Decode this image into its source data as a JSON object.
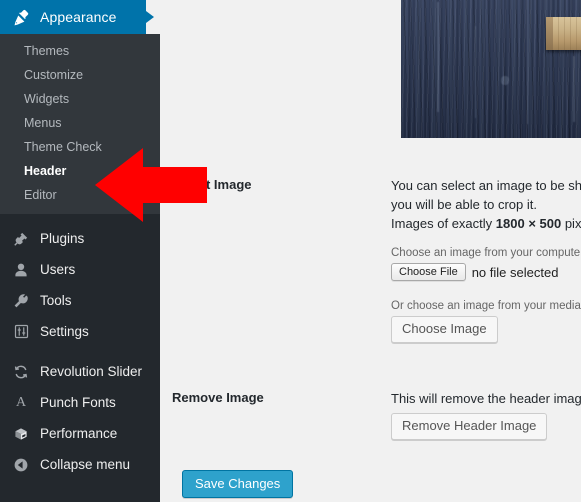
{
  "sidebar": {
    "top_menu": {
      "label": "Appearance",
      "icon": "paintbrush-icon",
      "background_color": "#0073aa",
      "expanded": true
    },
    "submenu": [
      {
        "label": "Themes",
        "current": false
      },
      {
        "label": "Customize",
        "current": false
      },
      {
        "label": "Widgets",
        "current": false
      },
      {
        "label": "Menus",
        "current": false
      },
      {
        "label": "Theme Check",
        "current": false
      },
      {
        "label": "Header",
        "current": true
      },
      {
        "label": "Editor",
        "current": false
      }
    ],
    "menu_items": [
      {
        "label": "Plugins",
        "icon": "plugin-icon"
      },
      {
        "label": "Users",
        "icon": "user-icon"
      },
      {
        "label": "Tools",
        "icon": "wrench-icon"
      },
      {
        "label": "Settings",
        "icon": "sliders-icon"
      }
    ],
    "plugin_items": [
      {
        "label": "Revolution Slider",
        "icon": "refresh-icon"
      },
      {
        "label": "Punch Fonts",
        "icon": "letter-a-icon"
      },
      {
        "label": "Performance",
        "icon": "cube-icon"
      },
      {
        "label": "Collapse menu",
        "icon": "collapse-icon"
      }
    ],
    "background_color": "#23282d",
    "submenu_background_color": "#32373c"
  },
  "header_preview": {
    "alt": "weathered blue painted wood planks with a tan wooden board",
    "visible": true
  },
  "main": {
    "select_image": {
      "label": "Select Image",
      "description_line_1": "You can select an image to be shown at the top of",
      "description_line_2": "you will be able to crop it.",
      "description_line_3_prefix": "Images of exactly ",
      "description_line_3_dimensions": "1800 × 500",
      "description_line_3_suffix": " pixels",
      "upload_label": "Choose an image from your computer:",
      "choose_file_button": "Choose File",
      "file_status": "no file selected",
      "library_label": "Or choose an image from your media library:",
      "choose_image_button": "Choose Image"
    },
    "remove_image": {
      "label": "Remove Image",
      "description": "This will remove the header image.",
      "button": "Remove Header Image"
    },
    "save_button": "Save Changes"
  },
  "colors": {
    "accent": "#0073aa",
    "primary_button": "#2ea2cc",
    "annotation_arrow": "#ff0000",
    "content_background": "#f1f1f1"
  }
}
